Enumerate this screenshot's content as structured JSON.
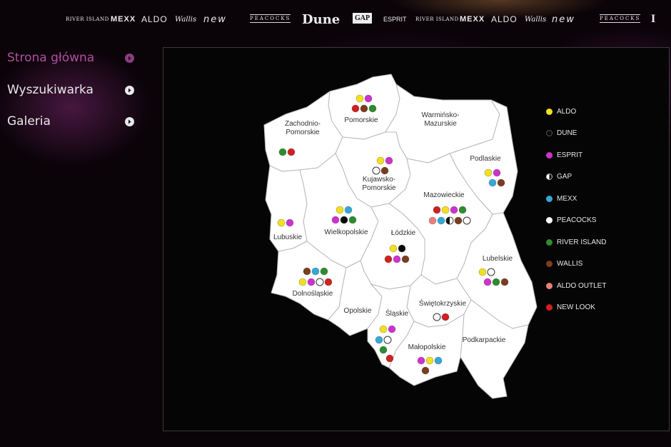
{
  "brands": {
    "items": [
      {
        "id": "river-island",
        "label": "RIVER ISLAND"
      },
      {
        "id": "mexx",
        "label": "MEXX"
      },
      {
        "id": "aldo",
        "label": "ALDO"
      },
      {
        "id": "wallis",
        "label": "Wallis"
      },
      {
        "id": "new-look",
        "label": "new"
      },
      {
        "id": "peacocks",
        "label": "PEACOCKS"
      },
      {
        "id": "dune",
        "label": "Dune"
      },
      {
        "id": "gap",
        "label": "GAP"
      },
      {
        "id": "esprit",
        "label": "ESPRIT"
      },
      {
        "id": "river-island-2",
        "label": "RIVER ISLAND"
      },
      {
        "id": "mexx-2",
        "label": "MEXX"
      },
      {
        "id": "aldo-2",
        "label": "ALDO"
      },
      {
        "id": "wallis-2",
        "label": "Wallis"
      },
      {
        "id": "new-look-2",
        "label": "new"
      },
      {
        "id": "peacocks-2",
        "label": "PEACOCKS"
      },
      {
        "id": "i",
        "label": "I"
      }
    ]
  },
  "nav": {
    "items": [
      {
        "label": "Strona główna",
        "active": true
      },
      {
        "label": "Wyszukiwarka",
        "active": false
      },
      {
        "label": "Galeria",
        "active": false
      }
    ]
  },
  "colors": {
    "ALDO": "#f2e01f",
    "DUNE": "#0a0a0a",
    "ESPRIT": "#cc33cc",
    "GAP": "split",
    "MEXX": "#35a8d6",
    "PEACOCKS": "#ffffff",
    "RIVER ISLAND": "#2e8b2e",
    "WALLIS": "#7a3d1e",
    "ALDO OUTLET": "#e8807a",
    "NEW LOOK": "#d02020",
    "region_fill": "#ffffff",
    "region_border": "#b8b8b8",
    "nav_active": "#b04ea0"
  },
  "legend": {
    "items": [
      {
        "label": "ALDO",
        "icon": "aldo-dot"
      },
      {
        "label": "DUNE",
        "icon": "dune-dot"
      },
      {
        "label": "ESPRIT",
        "icon": "esprit-dot"
      },
      {
        "label": "GAP",
        "icon": "gap-dot"
      },
      {
        "label": "MEXX",
        "icon": "mexx-dot"
      },
      {
        "label": "PEACOCKS",
        "icon": "peacocks-dot"
      },
      {
        "label": "RIVER ISLAND",
        "icon": "river-island-dot"
      },
      {
        "label": "WALLIS",
        "icon": "wallis-dot"
      },
      {
        "label": "ALDO OUTLET",
        "icon": "aldo-outlet-dot"
      },
      {
        "label": "NEW LOOK",
        "icon": "new-look-dot"
      }
    ]
  },
  "regions": [
    {
      "name": "Pomorskie",
      "labels": [
        "Pomorskie"
      ],
      "stores": [
        "ALDO",
        "ESPRIT",
        "NEW LOOK",
        "WALLIS",
        "RIVER ISLAND"
      ]
    },
    {
      "name": "Zachodnio-Pomorskie",
      "labels": [
        "Zachodnio-",
        "Pomorskie"
      ],
      "stores": [
        "RIVER ISLAND",
        "NEW LOOK"
      ]
    },
    {
      "name": "Warmińsko-Mazurskie",
      "labels": [
        "Warmińsko-",
        "Mazurskie"
      ],
      "stores": []
    },
    {
      "name": "Podlaskie",
      "labels": [
        "Podlaskie"
      ],
      "stores": [
        "ALDO",
        "ESPRIT",
        "MEXX",
        "WALLIS"
      ]
    },
    {
      "name": "Kujawsko-Pomorskie",
      "labels": [
        "Kujawsko-",
        "Pomorskie"
      ],
      "stores": [
        "ALDO",
        "ESPRIT",
        "PEACOCKS",
        "WALLIS"
      ]
    },
    {
      "name": "Mazowieckie",
      "labels": [
        "Mazowieckie"
      ],
      "stores": [
        "NEW LOOK",
        "ALDO",
        "ESPRIT",
        "RIVER ISLAND",
        "ALDO OUTLET",
        "MEXX",
        "GAP",
        "WALLIS",
        "PEACOCKS"
      ]
    },
    {
      "name": "Wielkopolskie",
      "labels": [
        "Wielkopolskie"
      ],
      "stores": [
        "ALDO",
        "MEXX",
        "ESPRIT",
        "DUNE",
        "RIVER ISLAND"
      ]
    },
    {
      "name": "Lubuskie",
      "labels": [
        "Lubuskie"
      ],
      "stores": [
        "ALDO",
        "ESPRIT"
      ]
    },
    {
      "name": "Łódzkie",
      "labels": [
        "Łódzkie"
      ],
      "stores": [
        "ALDO",
        "DUNE",
        "NEW LOOK",
        "ESPRIT",
        "WALLIS"
      ]
    },
    {
      "name": "Lubelskie",
      "labels": [
        "Lubelskie"
      ],
      "stores": [
        "ALDO",
        "PEACOCKS",
        "ESPRIT",
        "RIVER ISLAND",
        "WALLIS"
      ]
    },
    {
      "name": "Dolnośląskie",
      "labels": [
        "Dolnośląskie"
      ],
      "stores": [
        "WALLIS",
        "MEXX",
        "RIVER ISLAND",
        "ALDO",
        "ESPRIT",
        "PEACOCKS",
        "NEW LOOK"
      ]
    },
    {
      "name": "Opolskie",
      "labels": [
        "Opolskie"
      ],
      "stores": []
    },
    {
      "name": "Świętokrzyskie",
      "labels": [
        "Świętokrzyskie"
      ],
      "stores": [
        "PEACOCKS",
        "NEW LOOK"
      ]
    },
    {
      "name": "Śląskie",
      "labels": [
        "Śląskie"
      ],
      "stores": [
        "ALDO",
        "ESPRIT",
        "MEXX",
        "PEACOCKS",
        "RIVER ISLAND",
        "NEW LOOK"
      ]
    },
    {
      "name": "Małopolskie",
      "labels": [
        "Małopolskie"
      ],
      "stores": [
        "ESPRIT",
        "ALDO",
        "MEXX",
        "WALLIS"
      ]
    },
    {
      "name": "Podkarpackie",
      "labels": [
        "Podkarpackie"
      ],
      "stores": []
    }
  ]
}
